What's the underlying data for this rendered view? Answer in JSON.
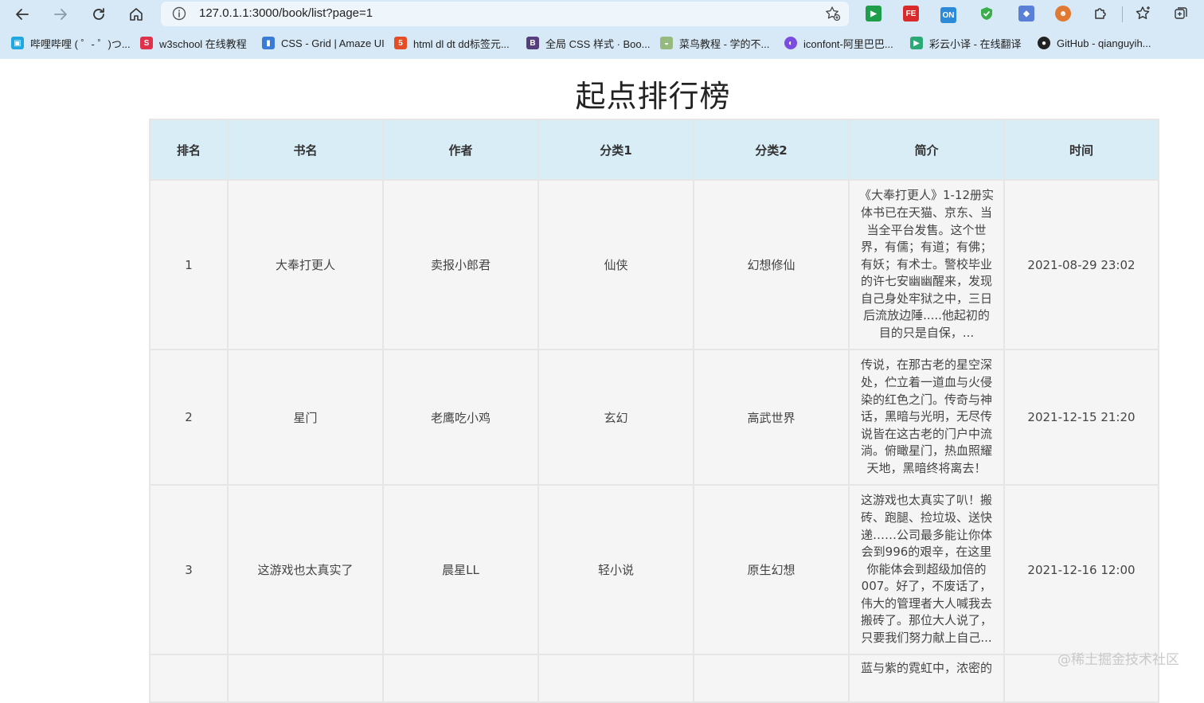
{
  "browser": {
    "url": "127.0.1.1:3000/book/list?page=1",
    "bookmarks": [
      {
        "label": "哔哩哔哩 ( ゜- ゜)つ...",
        "icon": "bilibili-icon",
        "color": "#20a7e0"
      },
      {
        "label": "w3school 在线教程",
        "icon": "w3school-icon",
        "color": "#e0314b"
      },
      {
        "label": "CSS - Grid | Amaze UI",
        "icon": "amazeui-icon",
        "color": "#3a7bd5"
      },
      {
        "label": "html dl dt dd标签元...",
        "icon": "html5-icon",
        "color": "#e44d26"
      },
      {
        "label": "全局 CSS 样式 · Boo...",
        "icon": "bootstrap-icon",
        "color": "#563d7c"
      },
      {
        "label": "菜鸟教程 - 学的不...",
        "icon": "runoob-icon",
        "color": "#96b97d"
      },
      {
        "label": "iconfont-阿里巴巴...",
        "icon": "iconfont-icon",
        "color": "#7b4ce0"
      },
      {
        "label": "彩云小译 - 在线翻译",
        "icon": "caiyun-icon",
        "color": "#2aa876"
      },
      {
        "label": "GitHub - qianguyih...",
        "icon": "github-icon",
        "color": "#222222"
      }
    ]
  },
  "page": {
    "title": "起点排行榜"
  },
  "table": {
    "headers": [
      "排名",
      "书名",
      "作者",
      "分类1",
      "分类2",
      "简介",
      "时间"
    ],
    "rows": [
      {
        "rank": "1",
        "name": "大奉打更人",
        "author": "卖报小郎君",
        "cat1": "仙侠",
        "cat2": "幻想修仙",
        "intro": "《大奉打更人》1-12册实体书已在天猫、京东、当当全平台发售。这个世界，有儒；有道；有佛；有妖；有术士。警校毕业的许七安幽幽醒来，发现自己身处牢狱之中，三日后流放边陲.....他起初的目的只是自保，...",
        "time": "2021-08-29 23:02"
      },
      {
        "rank": "2",
        "name": "星门",
        "author": "老鹰吃小鸡",
        "cat1": "玄幻",
        "cat2": "高武世界",
        "intro": "传说，在那古老的星空深处，伫立着一道血与火侵染的红色之门。传奇与神话，黑暗与光明，无尽传说皆在这古老的门户中流淌。俯瞰星门，热血照耀天地，黑暗终将离去！",
        "time": "2021-12-15 21:20"
      },
      {
        "rank": "3",
        "name": "这游戏也太真实了",
        "author": "晨星LL",
        "cat1": "轻小说",
        "cat2": "原生幻想",
        "intro": "这游戏也太真实了叭！搬砖、跑腿、捡垃圾、送快递……公司最多能让你体会到996的艰辛，在这里你能体会到超级加倍的007。好了，不废话了，伟大的管理者大人喊我去搬砖了。那位大人说了，只要我们努力献上自己...",
        "time": "2021-12-16 12:00"
      },
      {
        "rank": "",
        "name": "",
        "author": "",
        "cat1": "",
        "cat2": "",
        "intro": "蓝与紫的霓虹中，浓密的",
        "time": ""
      }
    ]
  },
  "watermark": "@稀土掘金技术社区"
}
